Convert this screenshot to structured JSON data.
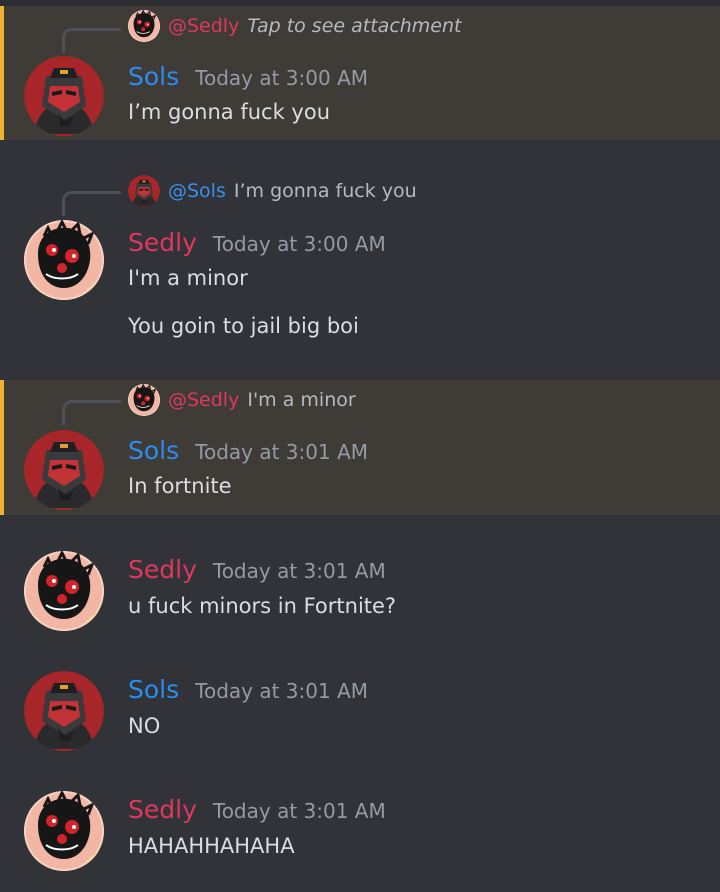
{
  "colors": {
    "sols": "#2d8cf0",
    "sedly": "#e0375e",
    "highlight_bg": "#3f3c37",
    "highlight_bar": "#f0b232",
    "bg": "#313338",
    "timestamp": "#949ba4"
  },
  "messages": [
    {
      "reply": {
        "name": "@Sedly",
        "text": "Tap to see attachment"
      },
      "author": "Sols",
      "timestamp": "Today at 3:00 AM",
      "lines": [
        "I’m gonna fuck you"
      ]
    },
    {
      "reply": {
        "name": "@Sols",
        "text": "I’m gonna fuck you"
      },
      "author": "Sedly",
      "timestamp": "Today at 3:00 AM",
      "lines": [
        "I'm a minor",
        "You goin to jail big boi"
      ]
    },
    {
      "reply": {
        "name": "@Sedly",
        "text": "I'm a minor"
      },
      "author": "Sols",
      "timestamp": "Today at 3:01 AM",
      "lines": [
        "In fortnite"
      ]
    },
    {
      "author": "Sedly",
      "timestamp": "Today at 3:01 AM",
      "lines": [
        "u fuck minors in Fortnite?"
      ]
    },
    {
      "author": "Sols",
      "timestamp": "Today at 3:01 AM",
      "lines": [
        "NO"
      ]
    },
    {
      "author": "Sedly",
      "timestamp": "Today at 3:01 AM",
      "lines": [
        "HAHAHHAHAHA"
      ]
    }
  ]
}
